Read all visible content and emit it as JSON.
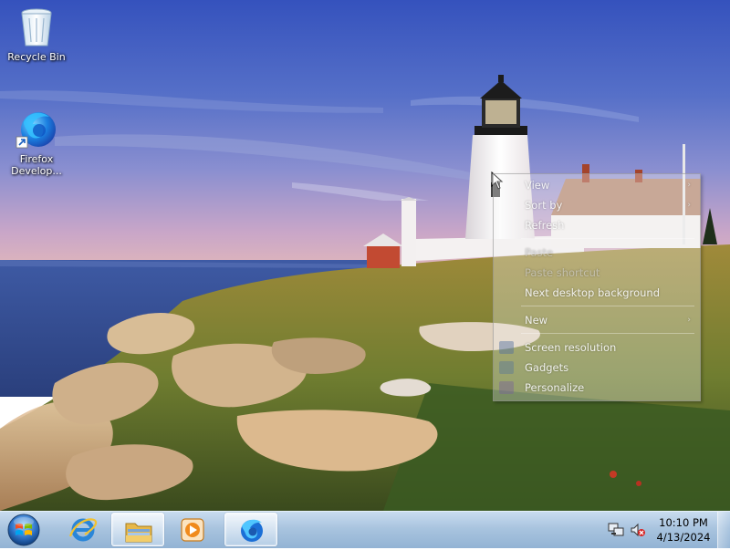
{
  "desktop": {
    "icons": [
      {
        "label": "Recycle Bin",
        "icon": "recycle-bin-icon"
      },
      {
        "label": "Firefox Develop...",
        "icon": "firefox-developer-icon"
      }
    ]
  },
  "context_menu": {
    "items": [
      {
        "label": "View",
        "enabled": true,
        "submenu": true
      },
      {
        "label": "Sort by",
        "enabled": true,
        "submenu": true
      },
      {
        "label": "Refresh",
        "enabled": true
      },
      {
        "label": "Paste",
        "enabled": false
      },
      {
        "label": "Paste shortcut",
        "enabled": false
      },
      {
        "label": "Next desktop background",
        "enabled": true
      },
      {
        "label": "New",
        "enabled": true,
        "submenu": true
      },
      {
        "label": "Screen resolution",
        "enabled": true,
        "icon": "screen-resolution-icon"
      },
      {
        "label": "Gadgets",
        "enabled": true,
        "icon": "gadgets-icon"
      },
      {
        "label": "Personalize",
        "enabled": true,
        "icon": "personalize-icon"
      }
    ],
    "submenu_arrow": "›"
  },
  "taskbar": {
    "start_icon": "windows-start-orb-icon",
    "pinned": [
      {
        "name": "Internet Explorer",
        "icon": "internet-explorer-icon"
      },
      {
        "name": "Windows Explorer",
        "icon": "folder-icon",
        "active": true
      },
      {
        "name": "Windows Media Player",
        "icon": "media-player-icon"
      },
      {
        "name": "Firefox Developer Edition",
        "icon": "firefox-developer-icon",
        "active": true
      }
    ],
    "tray": {
      "icons": [
        "network-icon",
        "volume-muted-icon"
      ]
    },
    "clock": {
      "time": "10:10 PM",
      "date": "4/13/2024"
    }
  },
  "colors": {
    "taskbar_top": "#c9dcef",
    "taskbar_bottom": "#93b3d4",
    "sky_top": "#3a56b8",
    "sea": "#3d5fa6"
  }
}
